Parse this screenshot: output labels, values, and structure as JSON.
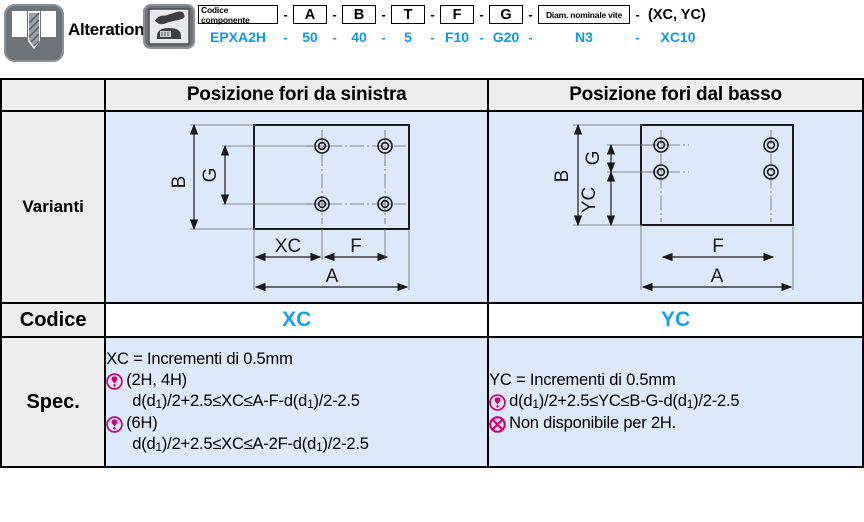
{
  "header": {
    "drill_icon_name": "drill-chamfer-icon",
    "phone_icon_name": "telephone-icon",
    "alterations_label": "Alterations",
    "code_builder": {
      "fields": [
        {
          "label": "Codice componente",
          "value": "EPXA2H",
          "tiny": true
        },
        {
          "label": "A",
          "value": "50",
          "tiny": false
        },
        {
          "label": "B",
          "value": "40",
          "tiny": false
        },
        {
          "label": "T",
          "value": "5",
          "tiny": false
        },
        {
          "label": "F",
          "value": "F10",
          "tiny": false
        },
        {
          "label": "G",
          "value": "G20",
          "tiny": false
        },
        {
          "label": "Diam. nominale vite",
          "value": "N3",
          "tiny": true
        }
      ],
      "tail_label": "(XC, YC)",
      "tail_value": "XC10",
      "separator": "-"
    }
  },
  "table": {
    "column_headers": {
      "corner": "",
      "left": "Posizione fori da sinistra",
      "right": "Posizione fori dal basso"
    },
    "rows": {
      "varianti": {
        "label": "Varianti",
        "left_diagram": {
          "dims": [
            "B",
            "G",
            "XC",
            "F",
            "A"
          ],
          "holes": 4
        },
        "right_diagram": {
          "dims": [
            "B",
            "G",
            "YC",
            "F",
            "A"
          ],
          "holes": 4
        }
      },
      "codice": {
        "label": "Codice",
        "left_value": "XC",
        "right_value": "YC"
      },
      "spec": {
        "label": "Spec.",
        "left_lines": [
          {
            "icon": "",
            "text": "XC = Incrementi di 0.5mm",
            "indent": false
          },
          {
            "icon": "warn",
            "text": "(2H, 4H)",
            "indent": false
          },
          {
            "icon": "",
            "text": "d(d₁)/2+2.5≤XC≤A-F-d(d₁)/2-2.5",
            "indent": true
          },
          {
            "icon": "warn",
            "text": "(6H)",
            "indent": false
          },
          {
            "icon": "",
            "text": "d(d₁)/2+2.5≤XC≤A-2F-d(d₁)/2-2.5",
            "indent": true
          }
        ],
        "right_lines": [
          {
            "icon": "",
            "text": "YC = Incrementi di 0.5mm",
            "indent": false
          },
          {
            "icon": "warn",
            "text": "d(d₁)/2+2.5≤YC≤B-G-d(d₁)/2-2.5",
            "indent": false
          },
          {
            "icon": "no",
            "text": "Non disponibile per 2H.",
            "indent": false
          }
        ]
      }
    }
  },
  "colors": {
    "accent_blue": "#18a0e8",
    "code_blue": "#0d9ae8",
    "diagram_bg": "#dbe9fa",
    "header_gray": "#ededed",
    "icon_magenta": "#cc0077"
  }
}
